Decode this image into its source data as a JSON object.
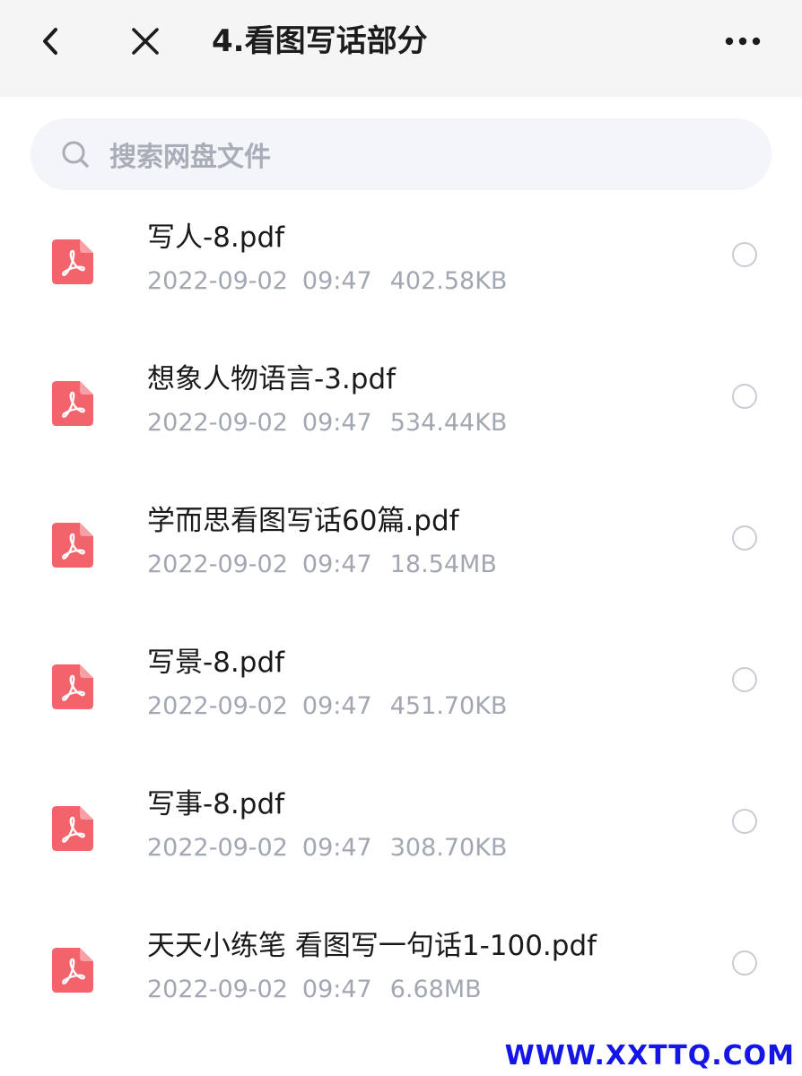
{
  "header": {
    "title": "4.看图写话部分"
  },
  "search": {
    "placeholder": "搜索网盘文件"
  },
  "files": [
    {
      "name": "写人-8.pdf",
      "date": "2022-09-02",
      "time": "09:47",
      "size": "402.58KB"
    },
    {
      "name": "想象人物语言-3.pdf",
      "date": "2022-09-02",
      "time": "09:47",
      "size": "534.44KB"
    },
    {
      "name": "学而思看图写话60篇.pdf",
      "date": "2022-09-02",
      "time": "09:47",
      "size": "18.54MB"
    },
    {
      "name": "写景-8.pdf",
      "date": "2022-09-02",
      "time": "09:47",
      "size": "451.70KB"
    },
    {
      "name": "写事-8.pdf",
      "date": "2022-09-02",
      "time": "09:47",
      "size": "308.70KB"
    },
    {
      "name": "天天小练笔 看图写一句话1-100.pdf",
      "date": "2022-09-02",
      "time": "09:47",
      "size": "6.68MB"
    }
  ],
  "watermark": "WWW.XXTTQ.COM",
  "colors": {
    "pdf_icon": "#f2636b",
    "header_bg": "#f5f5f5",
    "search_bg": "#f4f5f9",
    "meta_text": "#a3a7b1",
    "watermark": "#1515e8"
  }
}
